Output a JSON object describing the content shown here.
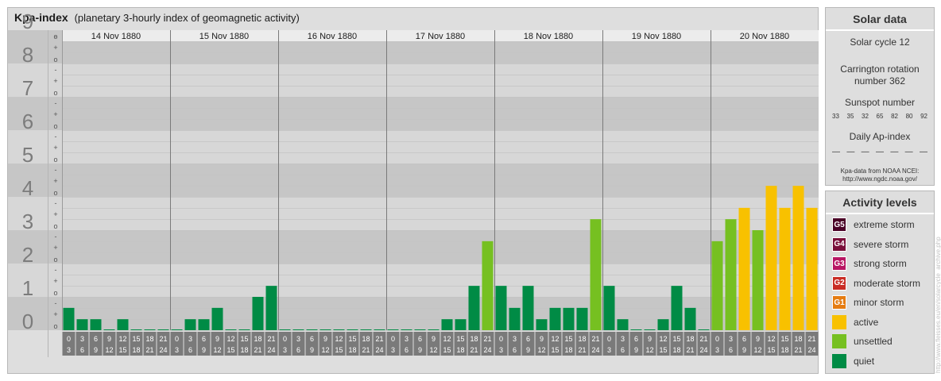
{
  "header": {
    "title": "Kpa-index",
    "subtitle": "(planetary 3-hourly index of geomagnetic activity)"
  },
  "chart_data": {
    "type": "bar",
    "ylim": [
      0,
      9
    ],
    "y_ticks": [
      "0",
      "1",
      "2",
      "3",
      "4",
      "5",
      "6",
      "7",
      "8",
      "9"
    ],
    "sub_ticks": [
      "o",
      "+",
      "-"
    ],
    "days": [
      "14 Nov 1880",
      "15 Nov 1880",
      "16 Nov 1880",
      "17 Nov 1880",
      "18 Nov 1880",
      "19 Nov 1880",
      "20 Nov 1880"
    ],
    "intervals": [
      [
        "0",
        "3"
      ],
      [
        "3",
        "6"
      ],
      [
        "6",
        "9"
      ],
      [
        "9",
        "12"
      ],
      [
        "12",
        "15"
      ],
      [
        "15",
        "18"
      ],
      [
        "18",
        "21"
      ],
      [
        "21",
        "24"
      ]
    ],
    "values": [
      [
        0.67,
        0.33,
        0.33,
        0,
        0.33,
        0,
        0,
        0
      ],
      [
        0,
        0.33,
        0.33,
        0.67,
        0,
        0,
        1,
        1.33
      ],
      [
        0,
        0,
        0,
        0,
        0,
        0,
        0,
        0
      ],
      [
        0,
        0,
        0,
        0,
        0.33,
        0.33,
        1.33,
        2.67
      ],
      [
        1.33,
        0.67,
        1.33,
        0.33,
        0.67,
        0.67,
        0.67,
        3.33
      ],
      [
        1.33,
        0.33,
        0,
        0,
        0.33,
        1.33,
        0.67,
        0
      ],
      [
        2.67,
        3.33,
        3.67,
        3,
        4.33,
        3.67,
        4.33,
        3.67
      ]
    ],
    "colors": {
      "quiet": "#008b45",
      "unsettled": "#76c021",
      "active": "#f8c100",
      "minor": "#e57c12",
      "band_dark": "#c6c6c6",
      "band_light": "#d7d7d7",
      "grid": "#c3c3c3",
      "tick_box": "#7a7a7a"
    }
  },
  "solar": {
    "title": "Solar data",
    "cycle": "Solar cycle 12",
    "carrington_1": "Carrington rotation",
    "carrington_2": "number 362",
    "ssn_title": "Sunspot number",
    "ssn": [
      "33",
      "35",
      "32",
      "65",
      "82",
      "80",
      "92"
    ],
    "ap_title": "Daily Ap-index",
    "ap": [
      "—",
      "—",
      "—",
      "—",
      "—",
      "—",
      "—"
    ],
    "source_1": "Kpa-data from NOAA NCEI:",
    "source_2": "http://www.ngdc.noaa.gov/"
  },
  "activity": {
    "title": "Activity levels",
    "levels": [
      {
        "badge": "G5",
        "label": "extreme storm",
        "color": "#4a0026"
      },
      {
        "badge": "G4",
        "label": "severe storm",
        "color": "#7a0f3a"
      },
      {
        "badge": "G3",
        "label": "strong storm",
        "color": "#b81663"
      },
      {
        "badge": "G2",
        "label": "moderate storm",
        "color": "#c92c24"
      },
      {
        "badge": "G1",
        "label": "minor storm",
        "color": "#e57c12"
      },
      {
        "badge": "",
        "label": "active",
        "color": "#f8c100"
      },
      {
        "badge": "",
        "label": "unsettled",
        "color": "#76c021"
      },
      {
        "badge": "",
        "label": "quiet",
        "color": "#008b45"
      }
    ]
  },
  "watermark": "http://www.fleisses.eu/en/solarcycle_archive.php"
}
